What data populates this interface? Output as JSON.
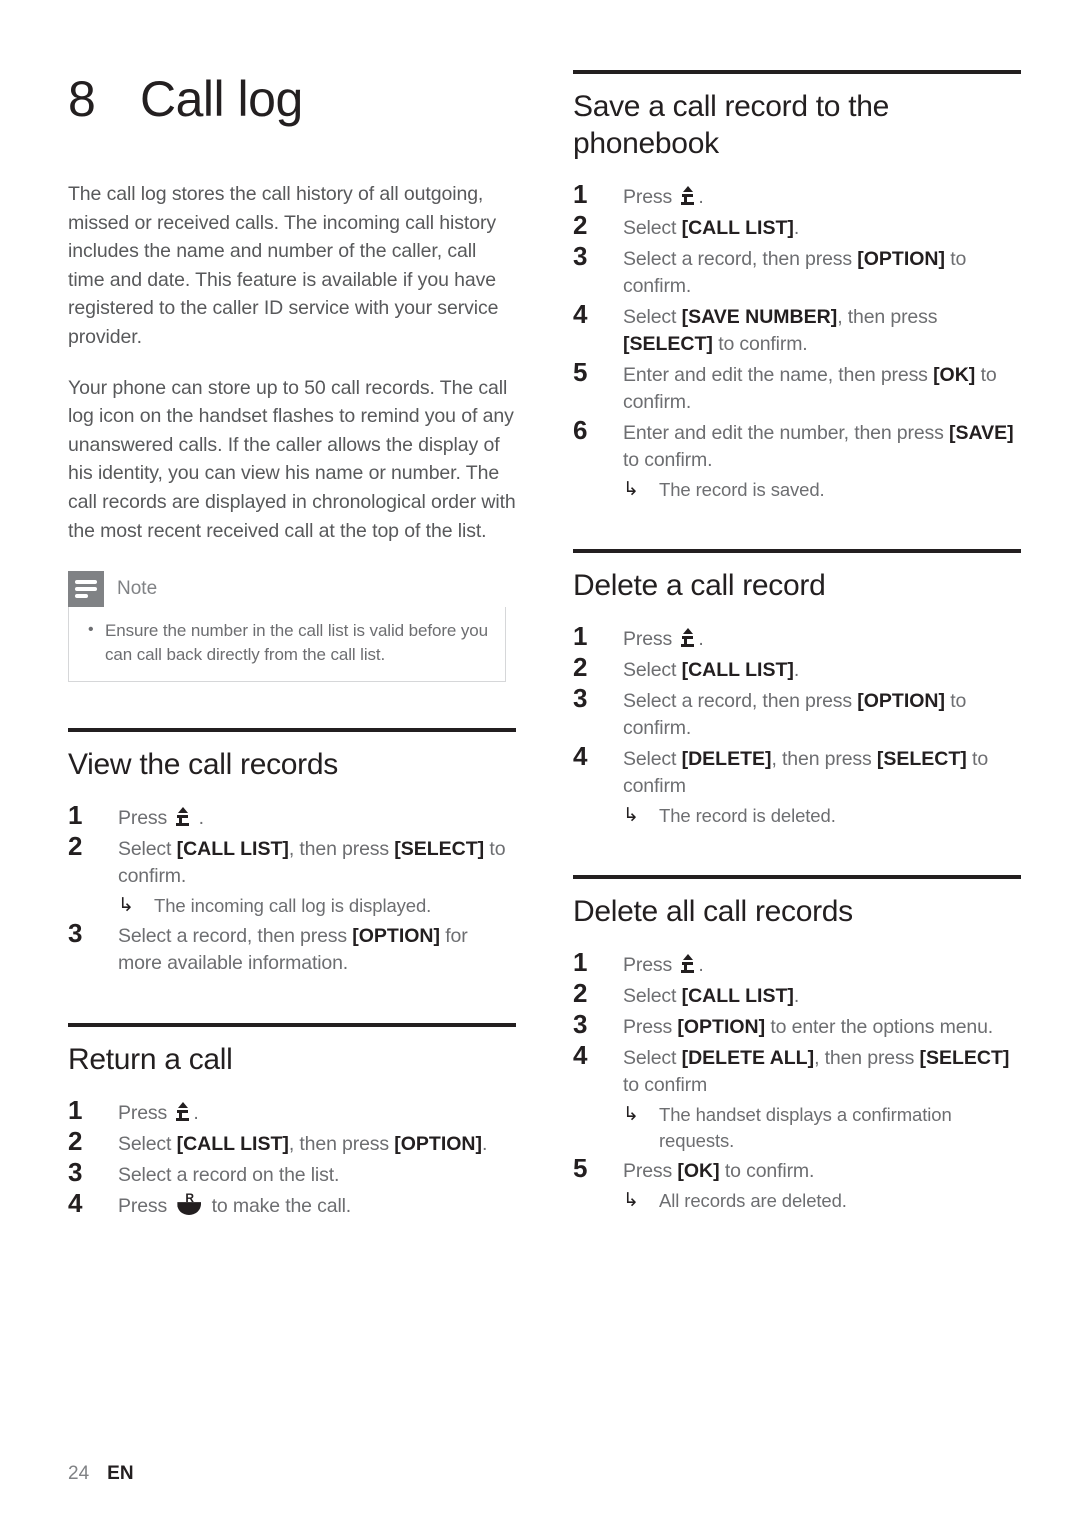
{
  "chapter": {
    "number": "8",
    "title": "Call log"
  },
  "intro": {
    "paragraph1": "The call log stores the call history of all outgoing, missed or received calls. The incoming call history includes the name and number of the caller, call time and date. This feature is available if you have registered to the caller ID service with your service provider.",
    "paragraph2": "Your phone can store up to 50 call records. The call log icon on the handset flashes to remind you of any unanswered calls. If the caller allows the display of his identity, you can view his name or number. The call records are displayed in chronological order with the most recent received call at the top of the list."
  },
  "note": {
    "icon": "note-lines-icon",
    "label": "Note",
    "items": [
      "Ensure the number in the call list is valid before you can call back directly from the call list."
    ]
  },
  "sections": {
    "view_call_records": {
      "title": "View the call records",
      "steps": [
        {
          "pre": "Press ",
          "icon": "menu-key-icon",
          "post": " ."
        },
        {
          "pre": "Select ",
          "key1": "[CALL LIST]",
          "mid": ", then press ",
          "key2": "[SELECT]",
          "post": " to confirm.",
          "result": "The incoming call log is displayed."
        },
        {
          "pre": "Select a record, then press ",
          "key1": "[OPTION]",
          "post": " for more available information."
        }
      ]
    },
    "return_a_call": {
      "title": "Return a call",
      "steps": [
        {
          "pre": "Press ",
          "icon": "menu-key-icon",
          "post": "."
        },
        {
          "pre": "Select ",
          "key1": "[CALL LIST]",
          "mid": ", then press ",
          "key2": "[OPTION]",
          "post": "."
        },
        {
          "pre": "Select a record on the list."
        },
        {
          "pre": "Press ",
          "icon": "handset-call-icon",
          "post": " to make the call."
        }
      ]
    },
    "save_to_phonebook": {
      "title": "Save a call record to the phonebook",
      "steps": [
        {
          "pre": "Press ",
          "icon": "menu-key-icon",
          "post": "."
        },
        {
          "pre": "Select ",
          "key1": "[CALL LIST]",
          "post": "."
        },
        {
          "pre": "Select a record, then press ",
          "key1": "[OPTION]",
          "post": " to confirm."
        },
        {
          "pre": "Select ",
          "key1": "[SAVE NUMBER]",
          "mid": ", then press ",
          "key2": "[SELECT]",
          "post": " to confirm."
        },
        {
          "pre": "Enter and edit the name, then press ",
          "key1": "[OK]",
          "post": " to confirm."
        },
        {
          "pre": "Enter and edit the number, then press ",
          "key1": "[SAVE]",
          "post": " to confirm.",
          "result": "The record is saved."
        }
      ]
    },
    "delete_a_call_record": {
      "title": "Delete a call record",
      "steps": [
        {
          "pre": "Press ",
          "icon": "menu-key-icon",
          "post": "."
        },
        {
          "pre": "Select ",
          "key1": "[CALL LIST]",
          "post": "."
        },
        {
          "pre": "Select a record, then press ",
          "key1": "[OPTION]",
          "post": " to confirm."
        },
        {
          "pre": "Select ",
          "key1": "[DELETE]",
          "mid": ", then press ",
          "key2": "[SELECT]",
          "post": " to confirm",
          "result": "The record is deleted."
        }
      ]
    },
    "delete_all_call_records": {
      "title": "Delete all call records",
      "steps": [
        {
          "pre": "Press ",
          "icon": "menu-key-icon",
          "post": "."
        },
        {
          "pre": "Select ",
          "key1": "[CALL LIST]",
          "post": "."
        },
        {
          "pre": "Press ",
          "key1": "[OPTION]",
          "post": " to enter the options menu."
        },
        {
          "pre": "Select ",
          "key1": "[DELETE ALL]",
          "mid": ", then press ",
          "key2": "[SELECT]",
          "post": " to confirm",
          "result": "The handset displays a confirmation requests."
        },
        {
          "pre": "Press ",
          "key1": "[OK]",
          "post": " to confirm.",
          "result": "All records are deleted."
        }
      ]
    }
  },
  "footer": {
    "page_number": "24",
    "language": "EN"
  },
  "colors": {
    "rule": "#231f20",
    "body_text": "#6d6e71",
    "note_icon_bg": "#808285"
  }
}
